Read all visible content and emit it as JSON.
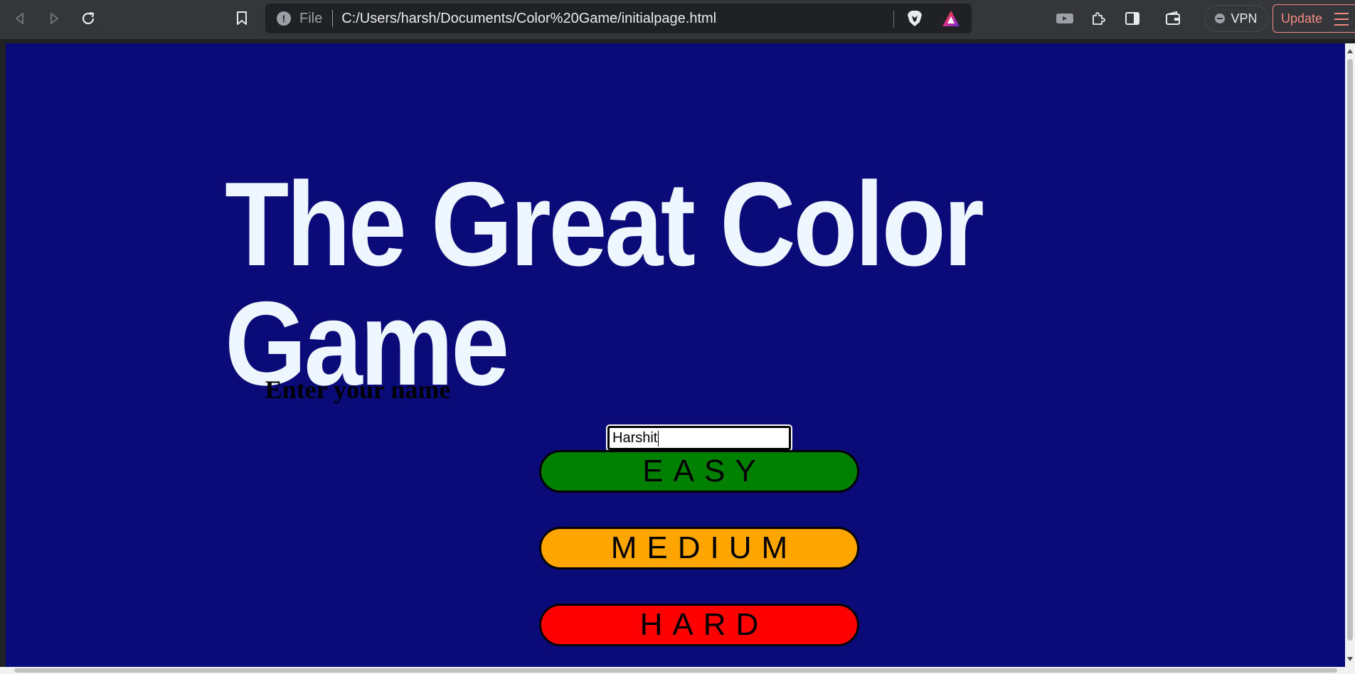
{
  "browser": {
    "file_label": "File",
    "url": "C:/Users/harsh/Documents/Color%20Game/initialpage.html",
    "vpn_label": "VPN",
    "update_label": "Update"
  },
  "page": {
    "title": "The Great Color Game",
    "name_prompt": "Enter your name",
    "name_value": "Harshit",
    "buttons": {
      "easy": "EASY",
      "medium": "MEDIUM",
      "hard": "HARD"
    },
    "colors": {
      "background": "#0a0b78",
      "title": "#eef6ff",
      "easy": "#008000",
      "medium": "#ffa500",
      "hard": "#ff0000"
    }
  }
}
